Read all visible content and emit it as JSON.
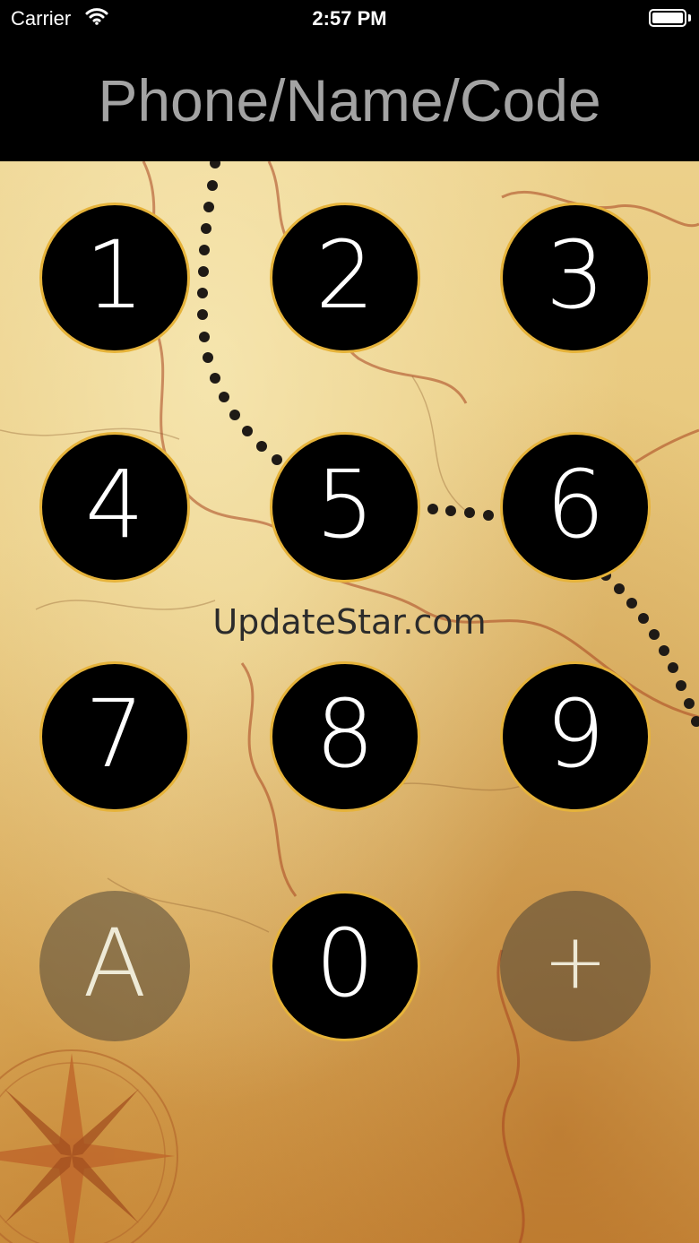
{
  "status_bar": {
    "carrier": "Carrier",
    "time": "2:57 PM",
    "battery_level": 1.0
  },
  "header": {
    "title": "Phone/Name/Code"
  },
  "watermark": "UpdateStar.com",
  "keypad": {
    "keys": [
      {
        "label": "1"
      },
      {
        "label": "2"
      },
      {
        "label": "3"
      },
      {
        "label": "4"
      },
      {
        "label": "5"
      },
      {
        "label": "6"
      },
      {
        "label": "7"
      },
      {
        "label": "8"
      },
      {
        "label": "9"
      },
      {
        "label": "A"
      },
      {
        "label": "0"
      },
      {
        "label": "+"
      }
    ]
  },
  "colors": {
    "key_fill": "#000000",
    "key_border": "#e6b33a",
    "header_text": "#a3a3a3",
    "map_background": "#e6c476"
  }
}
